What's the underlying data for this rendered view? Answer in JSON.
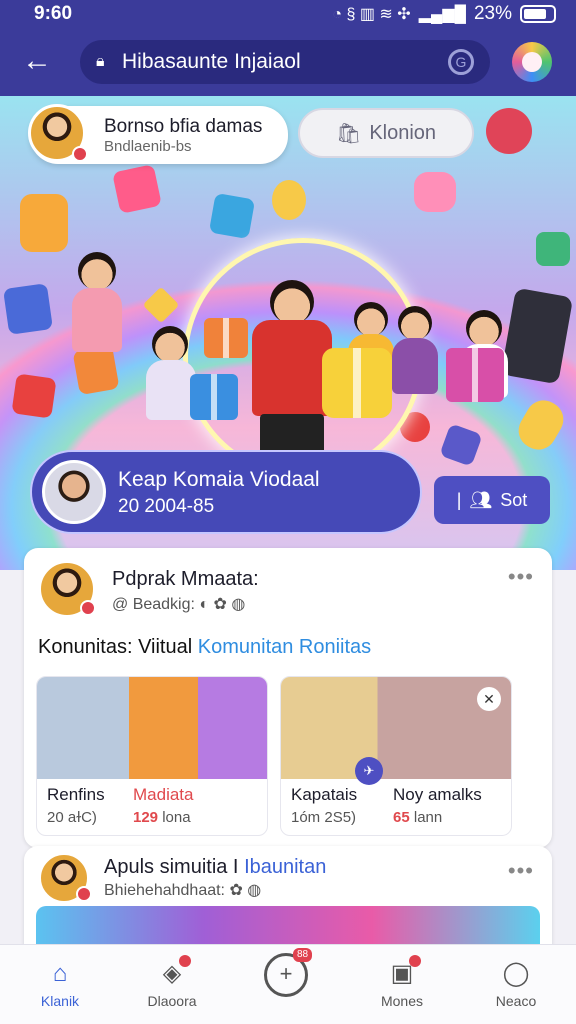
{
  "status_bar": {
    "time": "9:60",
    "battery": "23%"
  },
  "header": {
    "search_text": "Hibasaunte Injaiaol"
  },
  "hero": {
    "profile": {
      "name": "Bornso bfia damas",
      "subtitle": "Bndlaenib-bs"
    },
    "action_button": "Klonion",
    "channel": {
      "title": "Keap Komaia Viodaal",
      "subtitle": "20 2004-85"
    },
    "sort_button": "Sot"
  },
  "feed": [
    {
      "name": "Pdprak Mmaata:",
      "meta": "@ Beadkig:",
      "text_prefix": "Konunitas: Viitual",
      "text_link": "Komunitan Roniitas",
      "media": [
        {
          "label": "Renfins",
          "label2": "Madiata",
          "val": "20 aɫC)",
          "val2_num": "129",
          "val2_text": "lona"
        },
        {
          "label": "Kapatais",
          "label2": "Noy amalks",
          "val": "1óm 2S5)",
          "val2_num": "65",
          "val2_text": "lann"
        }
      ]
    },
    {
      "name_prefix": "Apuls simuitia I",
      "name_link": "Ibaunitan",
      "meta": "Bhiehehahdhaat:"
    }
  ],
  "nav": {
    "items": [
      {
        "label": "Klanik",
        "icon": "home-icon"
      },
      {
        "label": "Dlaoora",
        "icon": "tag-icon"
      },
      {
        "label": "",
        "icon": "add-icon",
        "badge": "88"
      },
      {
        "label": "Mones",
        "icon": "chat-icon"
      },
      {
        "label": "Neaco",
        "icon": "profile-icon"
      }
    ]
  },
  "colors": {
    "primary": "#3b3b9a",
    "accent": "#4e4fc2",
    "link": "#2f8de0",
    "badge": "#e0414e"
  }
}
